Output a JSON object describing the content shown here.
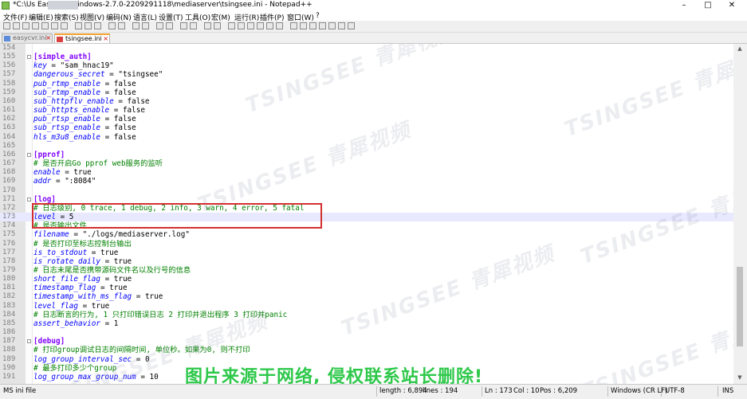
{
  "window": {
    "title": "*C:\\Us          EasyCVR-windows-2.7.0-2209291118\\mediaserver\\tsingsee.ini - Notepad++",
    "controls": [
      "–",
      "□",
      "✕"
    ]
  },
  "menu": [
    "文件(F)",
    "编辑(E)",
    "搜索(S)",
    "视图(V)",
    "编码(N)",
    "语言(L)",
    "设置(T)",
    "工具(O)",
    "宏(M)",
    "运行(R)",
    "插件(P)",
    "窗口(W)",
    "?"
  ],
  "tabs": [
    {
      "label": "easycvr.ini",
      "active": false
    },
    {
      "label": "tsingsee.ini",
      "active": true
    }
  ],
  "lines": [
    {
      "n": "154",
      "parts": []
    },
    {
      "n": "155",
      "parts": [
        [
          "sec",
          "[simple_auth]"
        ]
      ],
      "fold": true
    },
    {
      "n": "156",
      "parts": [
        [
          "k",
          "key"
        ],
        [
          "eq",
          " = "
        ],
        [
          "v",
          "\"sam_hnac19\""
        ]
      ]
    },
    {
      "n": "157",
      "parts": [
        [
          "k",
          "dangerous_secret"
        ],
        [
          "eq",
          " = "
        ],
        [
          "v",
          "\"tsingsee\""
        ]
      ]
    },
    {
      "n": "158",
      "parts": [
        [
          "k",
          "pub_rtmp_enable"
        ],
        [
          "eq",
          " = "
        ],
        [
          "v",
          "false"
        ]
      ]
    },
    {
      "n": "159",
      "parts": [
        [
          "k",
          "sub_rtmp_enable"
        ],
        [
          "eq",
          " = "
        ],
        [
          "v",
          "false"
        ]
      ]
    },
    {
      "n": "160",
      "parts": [
        [
          "k",
          "sub_httpflv_enable"
        ],
        [
          "eq",
          " = "
        ],
        [
          "v",
          "false"
        ]
      ]
    },
    {
      "n": "161",
      "parts": [
        [
          "k",
          "sub_httpts_enable"
        ],
        [
          "eq",
          " = "
        ],
        [
          "v",
          "false"
        ]
      ]
    },
    {
      "n": "162",
      "parts": [
        [
          "k",
          "pub_rtsp_enable"
        ],
        [
          "eq",
          " = "
        ],
        [
          "v",
          "false"
        ]
      ]
    },
    {
      "n": "163",
      "parts": [
        [
          "k",
          "sub_rtsp_enable"
        ],
        [
          "eq",
          " = "
        ],
        [
          "v",
          "false"
        ]
      ]
    },
    {
      "n": "164",
      "parts": [
        [
          "k",
          "hls_m3u8_enable"
        ],
        [
          "eq",
          " = "
        ],
        [
          "v",
          "false"
        ]
      ]
    },
    {
      "n": "165",
      "parts": []
    },
    {
      "n": "166",
      "parts": [
        [
          "sec",
          "[pprof]"
        ]
      ],
      "fold": true
    },
    {
      "n": "167",
      "parts": [
        [
          "c",
          "# 是否开启Go pprof web服务的监听"
        ]
      ]
    },
    {
      "n": "168",
      "parts": [
        [
          "k",
          "enable"
        ],
        [
          "eq",
          " = "
        ],
        [
          "v",
          "true"
        ]
      ]
    },
    {
      "n": "169",
      "parts": [
        [
          "k",
          "addr"
        ],
        [
          "eq",
          " = "
        ],
        [
          "v",
          "\":8084\""
        ]
      ]
    },
    {
      "n": "170",
      "parts": []
    },
    {
      "n": "171",
      "parts": [
        [
          "sec",
          "[log]"
        ]
      ],
      "fold": true
    },
    {
      "n": "172",
      "parts": [
        [
          "c",
          "# 日志级别, 0 trace, 1 debug, 2 info, 3 warn, 4 error, 5 fatal"
        ]
      ]
    },
    {
      "n": "173",
      "parts": [
        [
          "k",
          "level"
        ],
        [
          "eq",
          " = "
        ],
        [
          "v",
          "5"
        ]
      ],
      "caret": true
    },
    {
      "n": "174",
      "parts": [
        [
          "c",
          "# 是否输出文件"
        ]
      ]
    },
    {
      "n": "175",
      "parts": [
        [
          "k",
          "filename"
        ],
        [
          "eq",
          " = "
        ],
        [
          "v",
          "\"./logs/mediaserver.log\""
        ]
      ]
    },
    {
      "n": "176",
      "parts": [
        [
          "c",
          "# 是否打印至标志控制台输出"
        ]
      ]
    },
    {
      "n": "177",
      "parts": [
        [
          "k",
          "is_to_stdout"
        ],
        [
          "eq",
          " = "
        ],
        [
          "v",
          "true"
        ]
      ]
    },
    {
      "n": "178",
      "parts": [
        [
          "k",
          "is_rotate_daily"
        ],
        [
          "eq",
          " = "
        ],
        [
          "v",
          "true"
        ]
      ]
    },
    {
      "n": "179",
      "parts": [
        [
          "c",
          "# 日志末尾是否携带源码文件名以及行号的信息"
        ]
      ]
    },
    {
      "n": "180",
      "parts": [
        [
          "k",
          "short_file_flag"
        ],
        [
          "eq",
          " = "
        ],
        [
          "v",
          "true"
        ]
      ]
    },
    {
      "n": "181",
      "parts": [
        [
          "k",
          "timestamp_flag"
        ],
        [
          "eq",
          " = "
        ],
        [
          "v",
          "true"
        ]
      ]
    },
    {
      "n": "182",
      "parts": [
        [
          "k",
          "timestamp_with_ms_flag"
        ],
        [
          "eq",
          " = "
        ],
        [
          "v",
          "true"
        ]
      ]
    },
    {
      "n": "183",
      "parts": [
        [
          "k",
          "level_flag"
        ],
        [
          "eq",
          " = "
        ],
        [
          "v",
          "true"
        ]
      ]
    },
    {
      "n": "184",
      "parts": [
        [
          "c",
          "# 日志断言的行为, 1 只打印错误日志 2 打印并退出程序 3 打印并panic"
        ]
      ]
    },
    {
      "n": "185",
      "parts": [
        [
          "k",
          "assert_behavior"
        ],
        [
          "eq",
          " = "
        ],
        [
          "v",
          "1"
        ]
      ]
    },
    {
      "n": "186",
      "parts": []
    },
    {
      "n": "187",
      "parts": [
        [
          "sec",
          "[debug]"
        ]
      ],
      "fold": true
    },
    {
      "n": "188",
      "parts": [
        [
          "c",
          "# 打印group调试日志的间隔时间, 单位秒。如果为0, 则不打印"
        ]
      ]
    },
    {
      "n": "189",
      "parts": [
        [
          "k",
          "log_group_interval_sec"
        ],
        [
          "eq",
          " = "
        ],
        [
          "v",
          "0"
        ]
      ]
    },
    {
      "n": "190",
      "parts": [
        [
          "c",
          "# 最多打印多少个group"
        ]
      ]
    },
    {
      "n": "191",
      "parts": [
        [
          "k",
          "log_group_max_group_num"
        ],
        [
          "eq",
          " = "
        ],
        [
          "v",
          "10"
        ]
      ]
    }
  ],
  "status": {
    "file_type": "MS ini file",
    "length": "length : 6,894",
    "lines": "lines : 194",
    "ln": "Ln : 173",
    "col": "Col : 10",
    "pos": "Pos : 6,209",
    "eol": "Windows (CR LF)",
    "encoding": "UTF-8",
    "mode": "INS"
  },
  "watermark": "TSINGSEE 青犀视频",
  "credit": "图片来源于网络, 侵权联系站长删除!",
  "colors": {
    "section": "#8000ff",
    "key": "#0000ff",
    "comment": "#008000",
    "highlight_box": "#d43030",
    "credit": "#2ec84a"
  }
}
